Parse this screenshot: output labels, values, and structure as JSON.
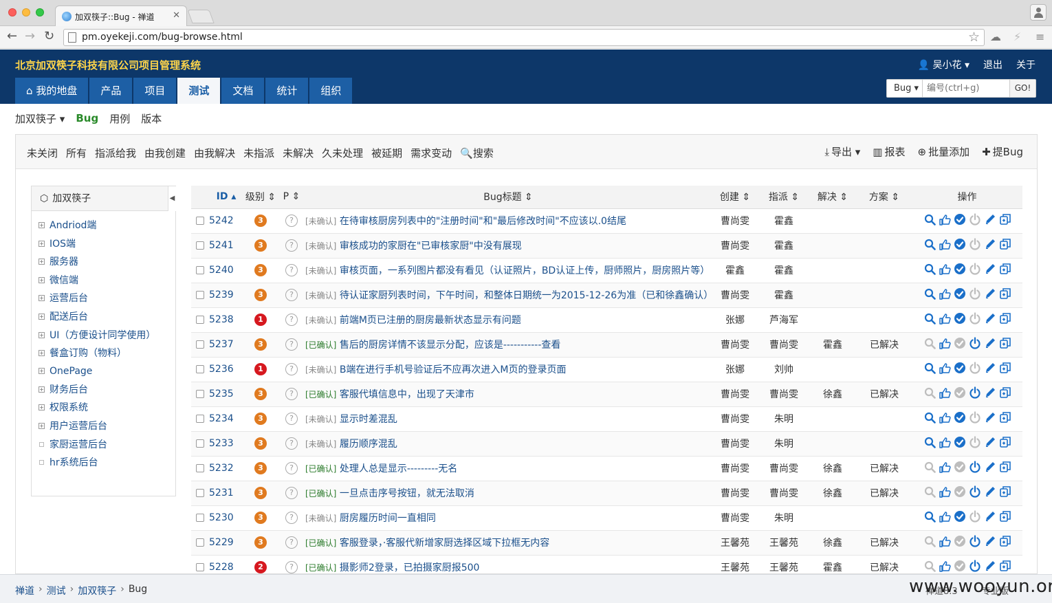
{
  "browser": {
    "tab_title": "加双筷子::Bug - 禅道",
    "url": "pm.oyekeji.com/bug-browse.html"
  },
  "header": {
    "app_title": "北京加双筷子科技有限公司项目管理系统",
    "user": "吴小花",
    "logout": "退出",
    "about": "关于",
    "nav": [
      "我的地盘",
      "产品",
      "项目",
      "测试",
      "文档",
      "统计",
      "组织"
    ],
    "search_type": "Bug",
    "search_placeholder": "编号(ctrl+g)",
    "search_go": "GO!"
  },
  "subnav": {
    "product": "加双筷子",
    "items": [
      "Bug",
      "用例",
      "版本"
    ]
  },
  "filters": [
    "未关闭",
    "所有",
    "指派给我",
    "由我创建",
    "由我解决",
    "未指派",
    "未解决",
    "久未处理",
    "被延期",
    "需求变动",
    "搜索"
  ],
  "actions": {
    "export": "导出",
    "report": "报表",
    "batch_add": "批量添加",
    "add_bug": "提Bug"
  },
  "sidebar": {
    "title": "加双筷子",
    "modules": [
      {
        "label": "Andriod端",
        "expandable": true
      },
      {
        "label": "IOS端",
        "expandable": true
      },
      {
        "label": "服务器",
        "expandable": true
      },
      {
        "label": "微信端",
        "expandable": true
      },
      {
        "label": "运营后台",
        "expandable": true
      },
      {
        "label": "配送后台",
        "expandable": true
      },
      {
        "label": "UI（方便设计同学使用）",
        "expandable": true
      },
      {
        "label": "餐盒订购（物料）",
        "expandable": true
      },
      {
        "label": "OnePage",
        "expandable": true
      },
      {
        "label": "财务后台",
        "expandable": true
      },
      {
        "label": "权限系统",
        "expandable": true
      },
      {
        "label": "用户运营后台",
        "expandable": true
      },
      {
        "label": "家厨运营后台",
        "expandable": false
      },
      {
        "label": "hr系统后台",
        "expandable": false
      }
    ]
  },
  "table": {
    "columns": [
      "ID",
      "级别",
      "P",
      "Bug标题",
      "创建",
      "指派",
      "解决",
      "方案",
      "操作"
    ],
    "priority_mark": "?",
    "rows": [
      {
        "id": "5242",
        "sev": "3",
        "status": "[未确认]",
        "title": "在待审核厨房列表中的\"注册时间\"和\"最后修改时间\"不应该以.0结尾",
        "creator": "曹尚雯",
        "assigned": "霍鑫",
        "resolver": "",
        "resolution": "",
        "confirmed": false
      },
      {
        "id": "5241",
        "sev": "3",
        "status": "[未确认]",
        "title": "审核成功的家厨在\"已审核家厨\"中没有展现",
        "creator": "曹尚雯",
        "assigned": "霍鑫",
        "resolver": "",
        "resolution": "",
        "confirmed": false
      },
      {
        "id": "5240",
        "sev": "3",
        "status": "[未确认]",
        "title": "审核页面，一系列图片都没有看见（认证照片，BD认证上传，厨师照片，厨房照片等）",
        "creator": "霍鑫",
        "assigned": "霍鑫",
        "resolver": "",
        "resolution": "",
        "confirmed": false
      },
      {
        "id": "5239",
        "sev": "3",
        "status": "[未确认]",
        "title": "待认证家厨列表时间，下午时间，和整体日期统一为2015-12-26为准（已和徐鑫确认）",
        "creator": "曹尚雯",
        "assigned": "霍鑫",
        "resolver": "",
        "resolution": "",
        "confirmed": false
      },
      {
        "id": "5238",
        "sev": "1",
        "status": "[未确认]",
        "title": "前端M页已注册的厨房最新状态显示有问题",
        "creator": "张娜",
        "assigned": "芦海军",
        "resolver": "",
        "resolution": "",
        "confirmed": false
      },
      {
        "id": "5237",
        "sev": "3",
        "status": "[已确认]",
        "title": "售后的厨房详情不该显示分配，应该是-----------查看",
        "creator": "曹尚雯",
        "assigned": "曹尚雯",
        "resolver": "霍鑫",
        "resolution": "已解决",
        "confirmed": true
      },
      {
        "id": "5236",
        "sev": "1",
        "status": "[未确认]",
        "title": "B端在进行手机号验证后不应再次进入M页的登录页面",
        "creator": "张娜",
        "assigned": "刘帅",
        "resolver": "",
        "resolution": "",
        "confirmed": false
      },
      {
        "id": "5235",
        "sev": "3",
        "status": "[已确认]",
        "title": "客服代填信息中，出现了天津市",
        "creator": "曹尚雯",
        "assigned": "曹尚雯",
        "resolver": "徐鑫",
        "resolution": "已解决",
        "confirmed": true
      },
      {
        "id": "5234",
        "sev": "3",
        "status": "[未确认]",
        "title": "显示时差混乱",
        "creator": "曹尚雯",
        "assigned": "朱明",
        "resolver": "",
        "resolution": "",
        "confirmed": false
      },
      {
        "id": "5233",
        "sev": "3",
        "status": "[未确认]",
        "title": "履历顺序混乱",
        "creator": "曹尚雯",
        "assigned": "朱明",
        "resolver": "",
        "resolution": "",
        "confirmed": false
      },
      {
        "id": "5232",
        "sev": "3",
        "status": "[已确认]",
        "title": "处理人总是显示---------无名",
        "creator": "曹尚雯",
        "assigned": "曹尚雯",
        "resolver": "徐鑫",
        "resolution": "已解决",
        "confirmed": true
      },
      {
        "id": "5231",
        "sev": "3",
        "status": "[已确认]",
        "title": "一旦点击序号按钮，就无法取消",
        "creator": "曹尚雯",
        "assigned": "曹尚雯",
        "resolver": "徐鑫",
        "resolution": "已解决",
        "confirmed": true
      },
      {
        "id": "5230",
        "sev": "3",
        "status": "[未确认]",
        "title": "厨房履历时间一直相同",
        "creator": "曹尚雯",
        "assigned": "朱明",
        "resolver": "",
        "resolution": "",
        "confirmed": false
      },
      {
        "id": "5229",
        "sev": "3",
        "status": "[已确认]",
        "title": "客服登录，·客服代新增家厨选择区域下拉框无内容",
        "creator": "王馨苑",
        "assigned": "王馨苑",
        "resolver": "徐鑫",
        "resolution": "已解决",
        "confirmed": true
      },
      {
        "id": "5228",
        "sev": "2",
        "status": "[已确认]",
        "title": "摄影师2登录，已拍摄家厨报500",
        "creator": "王馨苑",
        "assigned": "王馨苑",
        "resolver": "霍鑫",
        "resolution": "已解决",
        "confirmed": true
      }
    ]
  },
  "footer": {
    "breadcrumb": [
      "禅道",
      "测试",
      "加双筷子",
      "Bug"
    ],
    "version": "禅道8.3",
    "edition": "专业版",
    "watermark": "www.wooyun.org"
  },
  "colors": {
    "header_bg": "#0d3769",
    "title_yellow": "#ffd54a",
    "nav_blue": "#1d5fa5",
    "link_blue": "#1a4f8b",
    "sev3": "#e07a1f",
    "sev1": "#d6181f",
    "confirmed_green": "#2a7a2a"
  }
}
